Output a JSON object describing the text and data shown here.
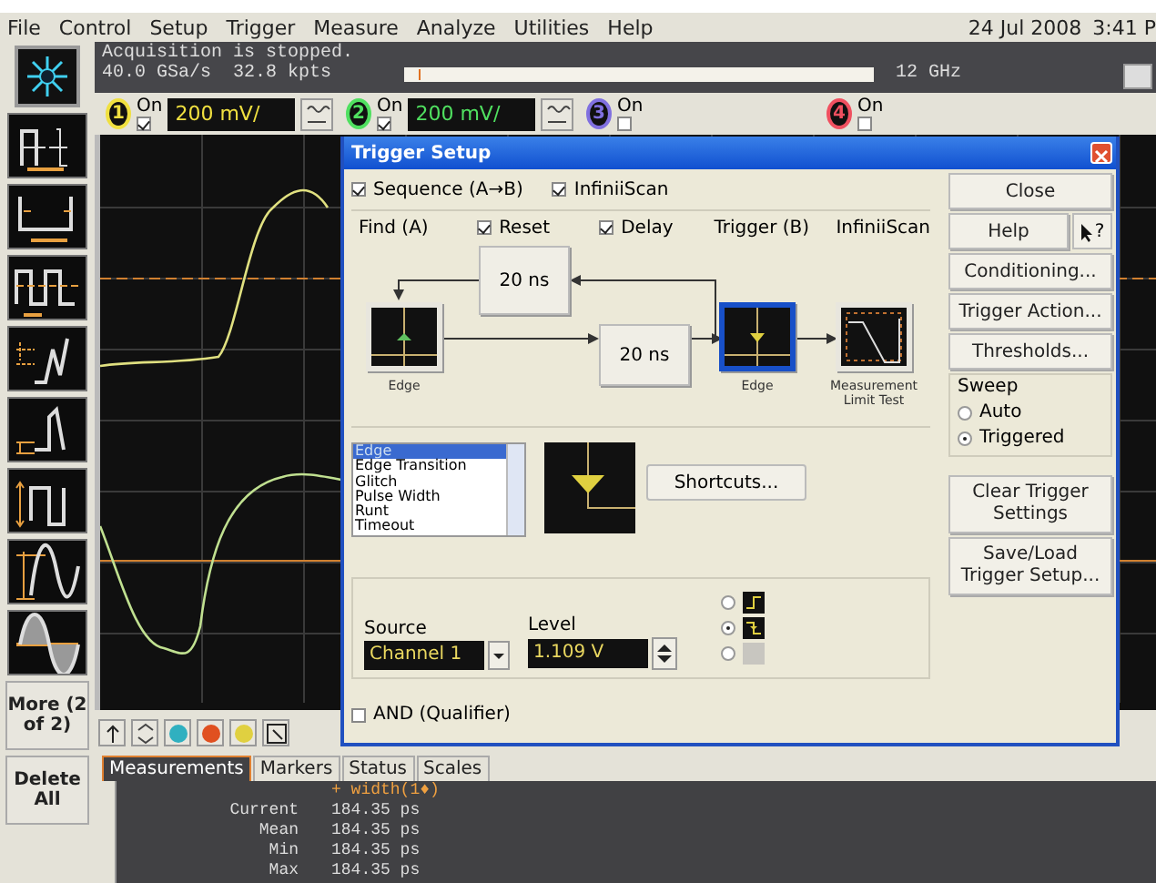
{
  "menu": [
    "File",
    "Control",
    "Setup",
    "Trigger",
    "Measure",
    "Analyze",
    "Utilities",
    "Help"
  ],
  "clock": {
    "date": "24 Jul 2008",
    "time": "3:41 P"
  },
  "status": {
    "message": "Acquisition is stopped.",
    "sample_rate": "40.0 GSa/s",
    "memory": "32.8 kpts",
    "bandwidth": "12 GHz"
  },
  "channels": [
    {
      "number": "1",
      "label": "On",
      "on": true,
      "scale": "200 mV/",
      "color": "#f0e040"
    },
    {
      "number": "2",
      "label": "On",
      "on": true,
      "scale": "200 mV/",
      "color": "#50e060"
    },
    {
      "number": "3",
      "label": "On",
      "on": false,
      "color": "#8070e0"
    },
    {
      "number": "4",
      "label": "On",
      "on": false,
      "color": "#f05060"
    }
  ],
  "side_buttons": [
    {
      "label": "More (2 of 2)"
    },
    {
      "label": "Delete All"
    }
  ],
  "dialog": {
    "title": "Trigger Setup",
    "options": [
      {
        "label": "Sequence (A→B)",
        "checked": true
      },
      {
        "label": "InfiniiScan",
        "checked": true
      }
    ],
    "flow": {
      "find_heading": "Find (A)",
      "reset": {
        "label": "Reset",
        "checked": true
      },
      "delay": {
        "label": "Delay",
        "checked": true
      },
      "trigger_heading": "Trigger (B)",
      "scan_heading": "InfiniiScan",
      "reset_time": "20 ns",
      "delay_time": "20 ns",
      "stages": [
        {
          "kind": "find",
          "label": "Edge",
          "selected": false
        },
        {
          "kind": "trigger",
          "label": "Edge",
          "selected": true
        },
        {
          "kind": "scan",
          "label": "Measurement Limit Test",
          "selected": false
        }
      ]
    },
    "trigger_types": [
      {
        "label": "Edge",
        "selected": true
      },
      {
        "label": "Edge Transition",
        "selected": false
      },
      {
        "label": "Glitch",
        "selected": false
      },
      {
        "label": "Pulse Width",
        "selected": false
      },
      {
        "label": "Runt",
        "selected": false
      },
      {
        "label": "Timeout",
        "selected": false
      }
    ],
    "shortcuts": "Shortcuts...",
    "source": {
      "label": "Source",
      "value": "Channel 1"
    },
    "level": {
      "label": "Level",
      "value": "1.109 V"
    },
    "slopes": [
      {
        "kind": "rising",
        "selected": false
      },
      {
        "kind": "falling",
        "selected": true
      },
      {
        "kind": "either",
        "selected": false
      }
    ],
    "qualifier": {
      "label": "AND (Qualifier)",
      "checked": false
    },
    "buttons": [
      {
        "kind": "close",
        "label": "Close"
      },
      {
        "kind": "help",
        "label": "Help",
        "extra": "?"
      },
      {
        "kind": "button",
        "label": "Conditioning..."
      },
      {
        "kind": "button",
        "label": "Trigger Action..."
      },
      {
        "kind": "button",
        "label": "Thresholds..."
      }
    ],
    "sweep": {
      "title": "Sweep",
      "options": [
        {
          "label": "Auto",
          "selected": false
        },
        {
          "label": "Triggered",
          "selected": true
        }
      ]
    },
    "lower_buttons": [
      {
        "label": "Clear Trigger Settings"
      },
      {
        "label": "Save/Load Trigger Setup..."
      }
    ]
  },
  "tabs": [
    {
      "label": "Measurements",
      "selected": true
    },
    {
      "label": "Markers",
      "selected": false
    },
    {
      "label": "Status",
      "selected": false
    },
    {
      "label": "Scales",
      "selected": false
    }
  ],
  "measurement": {
    "title": "+ width(1♦)",
    "rows": [
      {
        "label": "Current",
        "value": "184.35 ps"
      },
      {
        "label": "Mean",
        "value": "184.35 ps"
      },
      {
        "label": "Min",
        "value": "184.35 ps"
      },
      {
        "label": "Max",
        "value": "184.35 ps"
      }
    ]
  }
}
